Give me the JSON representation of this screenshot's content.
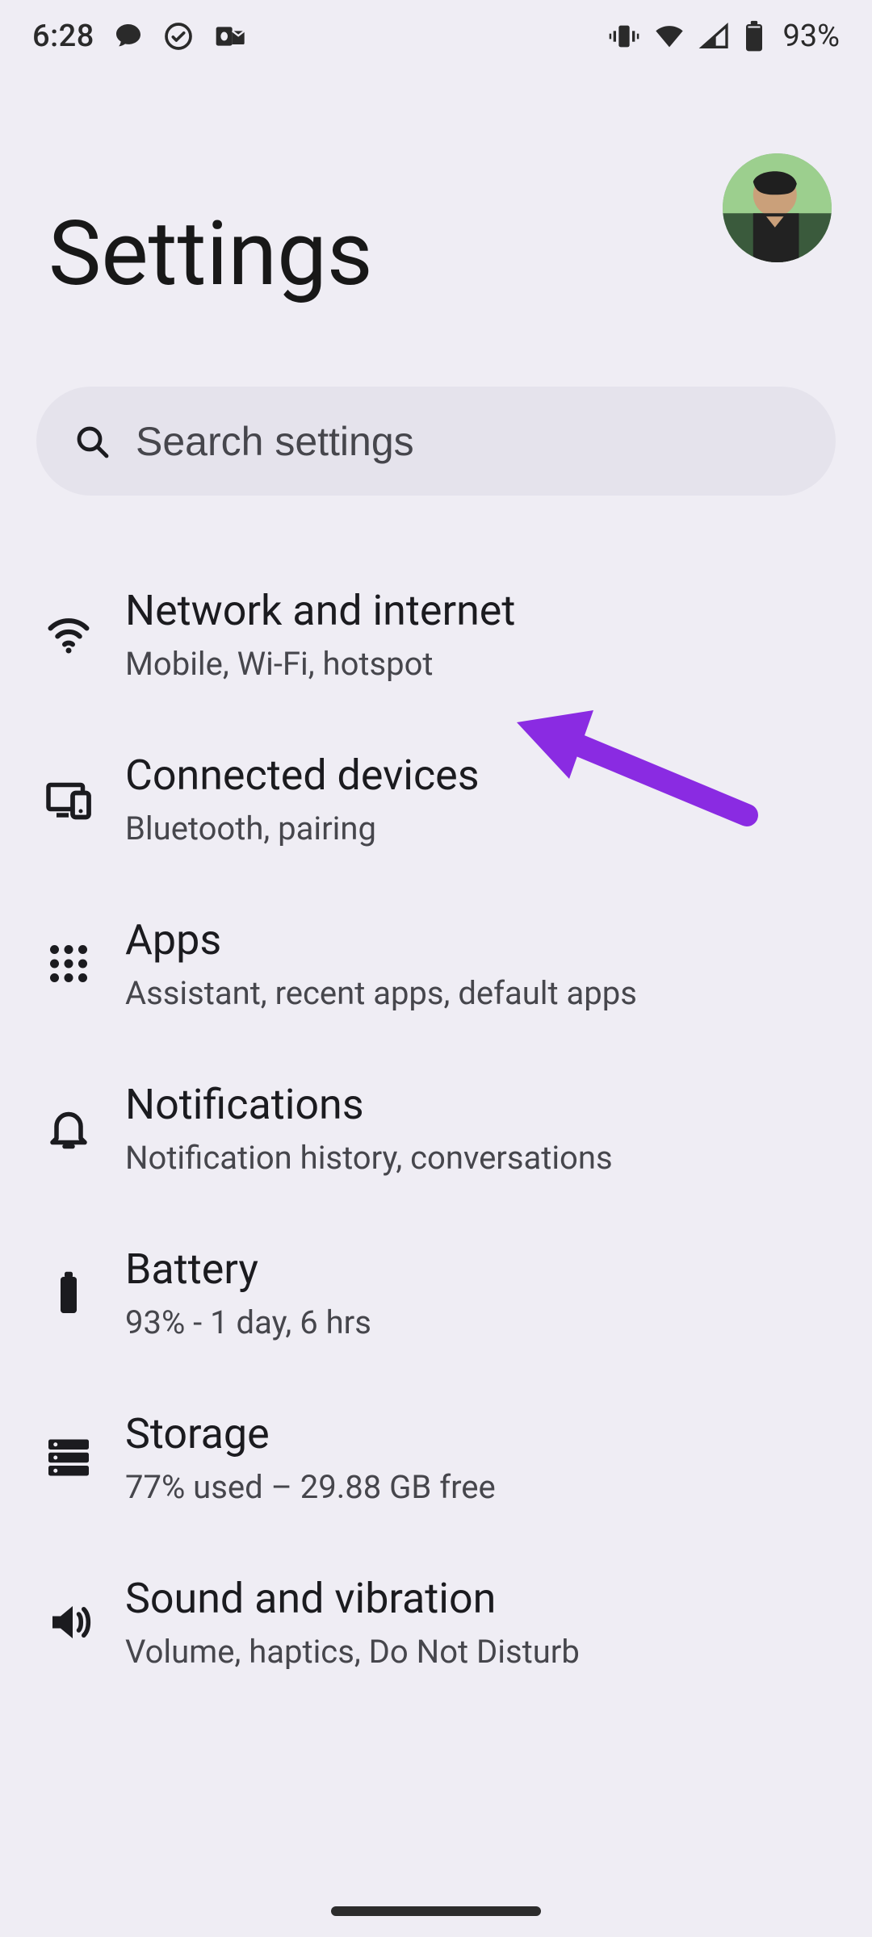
{
  "status": {
    "time": "6:28",
    "battery_pct": "93%"
  },
  "header": {
    "title": "Settings"
  },
  "search": {
    "placeholder": "Search settings"
  },
  "rows": [
    {
      "title": "Network and internet",
      "sub": "Mobile, Wi-Fi, hotspot"
    },
    {
      "title": "Connected devices",
      "sub": "Bluetooth, pairing"
    },
    {
      "title": "Apps",
      "sub": "Assistant, recent apps, default apps"
    },
    {
      "title": "Notifications",
      "sub": "Notification history, conversations"
    },
    {
      "title": "Battery",
      "sub": "93% - 1 day, 6 hrs"
    },
    {
      "title": "Storage",
      "sub": "77% used – 29.88 GB free"
    },
    {
      "title": "Sound and vibration",
      "sub": "Volume, haptics, Do Not Disturb"
    }
  ]
}
